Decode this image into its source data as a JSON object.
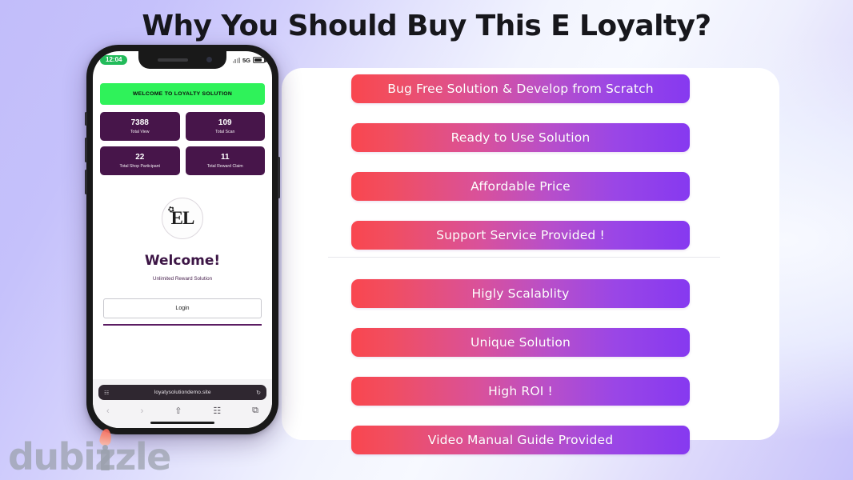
{
  "header": {
    "title": "Why You Should Buy This E Loyalty?"
  },
  "features": [
    {
      "label": "Bug Free Solution & Develop from Scratch"
    },
    {
      "label": "Ready to Use Solution"
    },
    {
      "label": "Affordable Price"
    },
    {
      "label": "Support Service Provided !"
    },
    {
      "label": "Higly Scalablity"
    },
    {
      "label": "Unique Solution"
    },
    {
      "label": "High ROI !"
    },
    {
      "label": "Video Manual Guide Provided"
    }
  ],
  "colors": {
    "gradient_start": "#f9464f",
    "gradient_end": "#8639f0",
    "banner_green": "#2ff25a",
    "stat_card_purple": "#47154a",
    "title_text": "#17171c",
    "background_lavender": "#c2bdfa"
  },
  "phone": {
    "status": {
      "clock": "12:04",
      "network": "5G"
    },
    "banner": "WELCOME TO LOYALTY SOLUTION",
    "stats": [
      {
        "value": "7388",
        "label": "Total View"
      },
      {
        "value": "109",
        "label": "Total Scan"
      },
      {
        "value": "22",
        "label": "Total Shop Participant"
      },
      {
        "value": "11",
        "label": "Total Reward Claim"
      }
    ],
    "logo_text": "EL",
    "welcome_heading": "Welcome!",
    "welcome_subtitle": "Unlimited Reward Solution",
    "login_label": "Login",
    "browser": {
      "url": "loyatysolutiondemo.site",
      "lock_icon": "A",
      "reader_icon": "☷",
      "reload_icon": "↻",
      "back_icon": "‹",
      "forward_icon": "›",
      "share_icon": "⇧",
      "bookmarks_icon": "☷",
      "tabs_icon": "⧉"
    }
  },
  "watermark": {
    "brand": "dubizzle"
  }
}
